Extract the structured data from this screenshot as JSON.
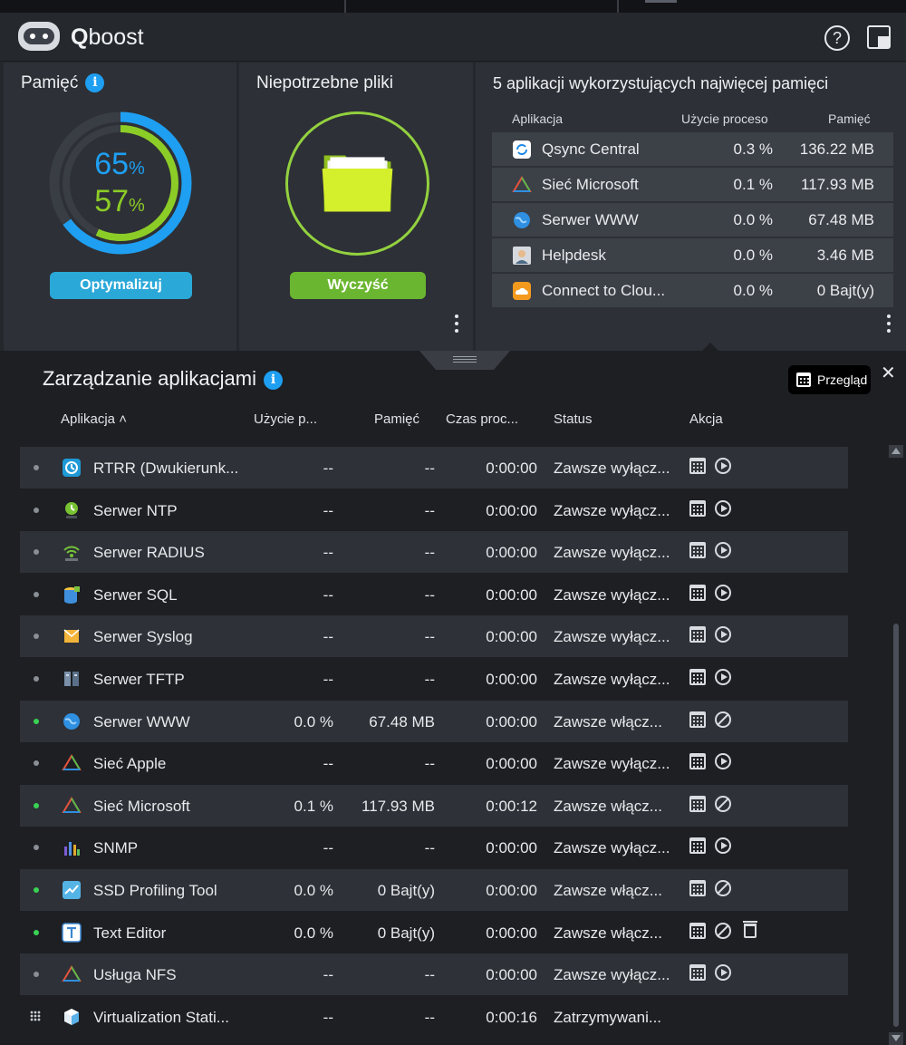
{
  "app": {
    "title_bold": "Q",
    "title_rest": "boost"
  },
  "memory": {
    "title": "Pamięć",
    "value_a": "65",
    "value_b": "57",
    "unit": "%",
    "button": "Optymalizuj",
    "color_a": "#1e9ff2",
    "color_b": "#8ccc27",
    "fill_a": 0.65,
    "fill_b": 0.57
  },
  "junk": {
    "title": "Niepotrzebne pliki",
    "button": "Wyczyść"
  },
  "top5": {
    "title": "5 aplikacji wykorzystujących najwięcej pamięci",
    "headers": {
      "app": "Aplikacja",
      "usage": "Użycie proceso",
      "mem": "Pamięć"
    },
    "rows": [
      {
        "name": "Qsync Central",
        "usage": "0.3 %",
        "mem": "136.22 MB",
        "icon": "qsync-icon"
      },
      {
        "name": "Sieć Microsoft",
        "usage": "0.1 %",
        "mem": "117.93 MB",
        "icon": "network-triangle-icon"
      },
      {
        "name": "Serwer WWW",
        "usage": "0.0 %",
        "mem": "67.48 MB",
        "icon": "globe-icon"
      },
      {
        "name": "Helpdesk",
        "usage": "0.0 %",
        "mem": "3.46 MB",
        "icon": "helpdesk-icon"
      },
      {
        "name": "Connect to Clou...",
        "usage": "0.0 %",
        "mem": "0 Bajt(y)",
        "icon": "cloud-icon"
      }
    ]
  },
  "manager": {
    "title": "Zarządzanie aplikacjami",
    "overview": "Przegląd",
    "headers": {
      "app": "Aplikacja ˄",
      "usage": "Użycie p...",
      "mem": "Pamięć",
      "time": "Czas proc...",
      "status": "Status",
      "action": "Akcja"
    },
    "rows": [
      {
        "name": "RTRR (Dwukierunk...",
        "usage": "--",
        "mem": "--",
        "time": "0:00:00",
        "status": "Zawsze wyłącz...",
        "state": "off",
        "icon": "rtrr-icon"
      },
      {
        "name": "Serwer NTP",
        "usage": "--",
        "mem": "--",
        "time": "0:00:00",
        "status": "Zawsze wyłącz...",
        "state": "off",
        "icon": "ntp-icon"
      },
      {
        "name": "Serwer RADIUS",
        "usage": "--",
        "mem": "--",
        "time": "0:00:00",
        "status": "Zawsze wyłącz...",
        "state": "off",
        "icon": "radius-icon"
      },
      {
        "name": "Serwer SQL",
        "usage": "--",
        "mem": "--",
        "time": "0:00:00",
        "status": "Zawsze wyłącz...",
        "state": "off",
        "icon": "sql-icon"
      },
      {
        "name": "Serwer Syslog",
        "usage": "--",
        "mem": "--",
        "time": "0:00:00",
        "status": "Zawsze wyłącz...",
        "state": "off",
        "icon": "syslog-icon"
      },
      {
        "name": "Serwer TFTP",
        "usage": "--",
        "mem": "--",
        "time": "0:00:00",
        "status": "Zawsze wyłącz...",
        "state": "off",
        "icon": "tftp-icon"
      },
      {
        "name": "Serwer WWW",
        "usage": "0.0 %",
        "mem": "67.48 MB",
        "time": "0:00:00",
        "status": "Zawsze włącz...",
        "state": "on",
        "icon": "globe-icon"
      },
      {
        "name": "Sieć Apple",
        "usage": "--",
        "mem": "--",
        "time": "0:00:00",
        "status": "Zawsze wyłącz...",
        "state": "off",
        "icon": "network-triangle-icon"
      },
      {
        "name": "Sieć Microsoft",
        "usage": "0.1 %",
        "mem": "117.93 MB",
        "time": "0:00:12",
        "status": "Zawsze włącz...",
        "state": "on",
        "icon": "network-triangle-icon"
      },
      {
        "name": "SNMP",
        "usage": "--",
        "mem": "--",
        "time": "0:00:00",
        "status": "Zawsze wyłącz...",
        "state": "off",
        "icon": "snmp-icon"
      },
      {
        "name": "SSD Profiling Tool",
        "usage": "0.0 %",
        "mem": "0 Bajt(y)",
        "time": "0:00:00",
        "status": "Zawsze włącz...",
        "state": "on",
        "icon": "ssd-icon"
      },
      {
        "name": "Text Editor",
        "usage": "0.0 %",
        "mem": "0 Bajt(y)",
        "time": "0:00:00",
        "status": "Zawsze włącz...",
        "state": "on",
        "icon": "text-editor-icon",
        "trash": true
      },
      {
        "name": "Usługa NFS",
        "usage": "--",
        "mem": "--",
        "time": "0:00:00",
        "status": "Zawsze wyłącz...",
        "state": "off",
        "icon": "network-triangle-icon"
      },
      {
        "name": "Virtualization Stati...",
        "usage": "--",
        "mem": "--",
        "time": "0:00:16",
        "status": "Zatrzymywani...",
        "state": "stopping",
        "icon": "virtualization-icon",
        "noactions": true
      }
    ]
  }
}
